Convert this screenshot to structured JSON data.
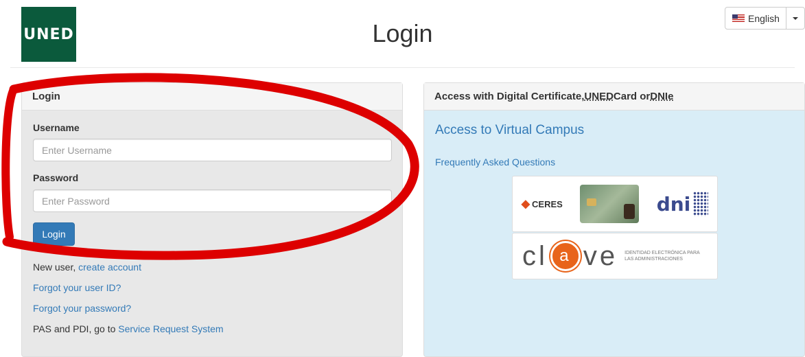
{
  "header": {
    "logo_text": "UNED",
    "title": "Login",
    "language": {
      "label": "English",
      "flag_icon": "us-flag-icon"
    }
  },
  "login_panel": {
    "heading": "Login",
    "username_label": "Username",
    "username_placeholder": "Enter Username",
    "username_value": "",
    "password_label": "Password",
    "password_placeholder": "Enter Password",
    "password_value": "",
    "login_button": "Login",
    "new_user_prefix": "New user, ",
    "create_account": "create account",
    "forgot_user_id": "Forgot your user ID?",
    "forgot_password": "Forgot your password?",
    "pas_prefix": "PAS and PDI, go to ",
    "service_request": "Service Request System"
  },
  "cert_panel": {
    "heading_prefix": "Access with Digital Certificate, ",
    "heading_uned": "UNED",
    "heading_mid": " Card or ",
    "heading_dnie": "DNIe",
    "virtual_campus": "Access to Virtual Campus",
    "faq": "Frequently Asked Questions",
    "logos": {
      "ceres": "CERES",
      "dni": "dni",
      "clave_left": "cl",
      "clave_mid": "a",
      "clave_right": "ve",
      "clave_sub": "IDENTIDAD ELECTRÓNICA PARA LAS ADMINISTRACIONES"
    }
  },
  "colors": {
    "brand_green": "#0b5a3c",
    "link_blue": "#337ab7",
    "annotation_red": "#dd0000",
    "clave_orange": "#e8641b"
  }
}
